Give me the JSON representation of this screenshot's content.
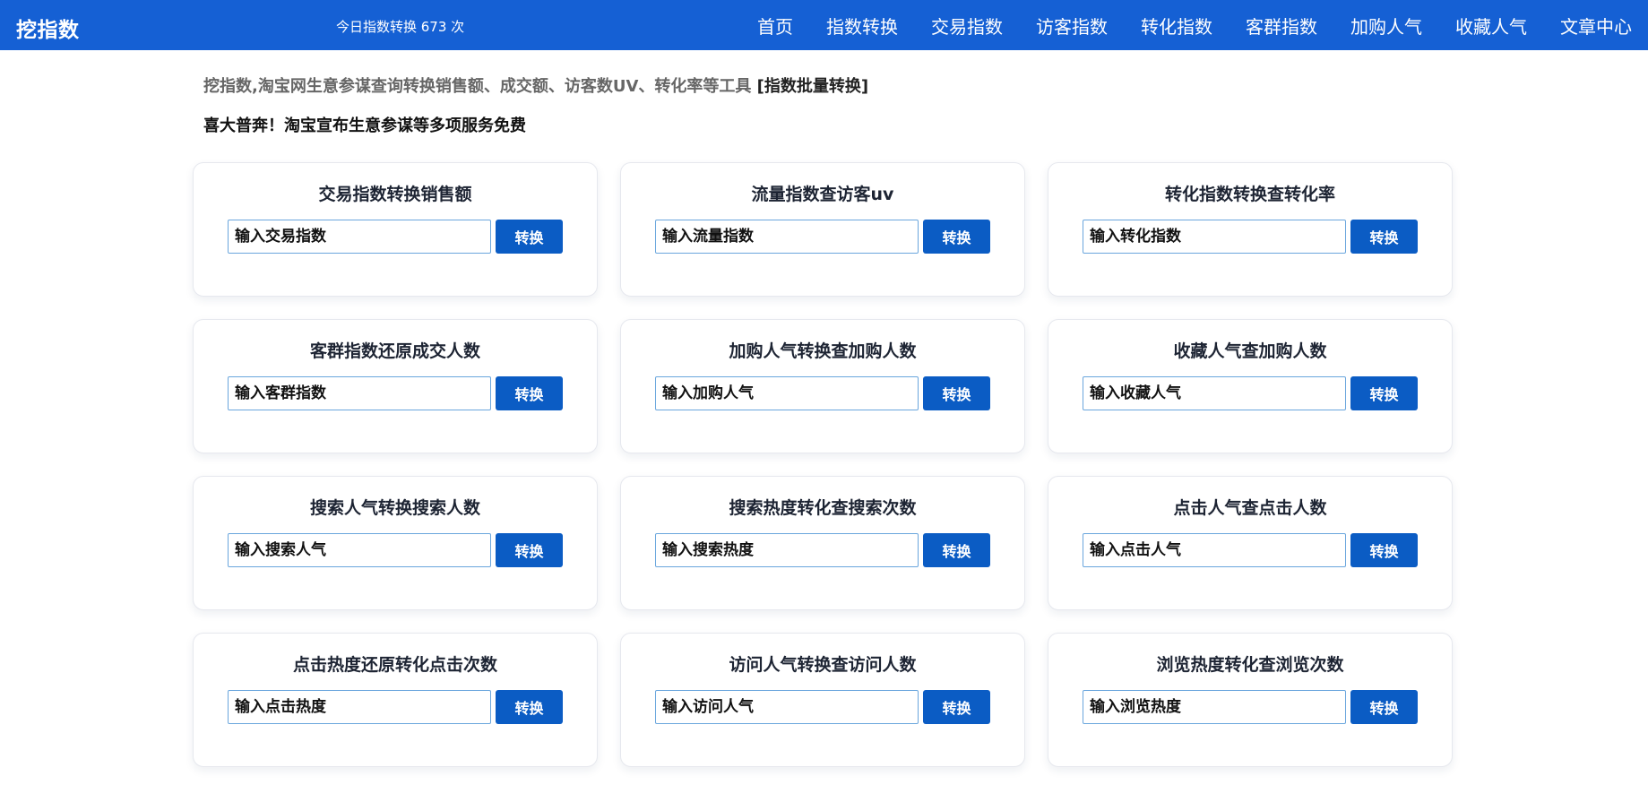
{
  "header": {
    "logo": "挖指数",
    "counter": "今日指数转换 673 次",
    "nav": [
      "首页",
      "指数转换",
      "交易指数",
      "访客指数",
      "转化指数",
      "客群指数",
      "加购人气",
      "收藏人气",
      "文章中心"
    ]
  },
  "intro": {
    "text": "挖指数,淘宝网生意参谋查询转换销售额、成交额、访客数UV、转化率等工具",
    "bracket_open": "[",
    "batch_link": "指数批量转换",
    "bracket_close": "]"
  },
  "notice": "喜大普奔！淘宝宣布生意参谋等多项服务免费",
  "cards": [
    {
      "title": "交易指数转换销售额",
      "placeholder": "输入交易指数",
      "button": "转换"
    },
    {
      "title": "流量指数查访客uv",
      "placeholder": "输入流量指数",
      "button": "转换"
    },
    {
      "title": "转化指数转换查转化率",
      "placeholder": "输入转化指数",
      "button": "转换"
    },
    {
      "title": "客群指数还原成交人数",
      "placeholder": "输入客群指数",
      "button": "转换"
    },
    {
      "title": "加购人气转换查加购人数",
      "placeholder": "输入加购人气",
      "button": "转换"
    },
    {
      "title": "收藏人气查加购人数",
      "placeholder": "输入收藏人气",
      "button": "转换"
    },
    {
      "title": "搜索人气转换搜索人数",
      "placeholder": "输入搜索人气",
      "button": "转换"
    },
    {
      "title": "搜索热度转化查搜索次数",
      "placeholder": "输入搜索热度",
      "button": "转换"
    },
    {
      "title": "点击人气查点击人数",
      "placeholder": "输入点击人气",
      "button": "转换"
    },
    {
      "title": "点击热度还原转化点击次数",
      "placeholder": "输入点击热度",
      "button": "转换"
    },
    {
      "title": "访问人气转换查访问人数",
      "placeholder": "输入访问人气",
      "button": "转换"
    },
    {
      "title": "浏览热度转化查浏览次数",
      "placeholder": "输入浏览热度",
      "button": "转换"
    }
  ],
  "colors": {
    "header_bg": "#1560d4",
    "button_bg": "#0b5cc4",
    "input_border": "#6aa6dd"
  }
}
